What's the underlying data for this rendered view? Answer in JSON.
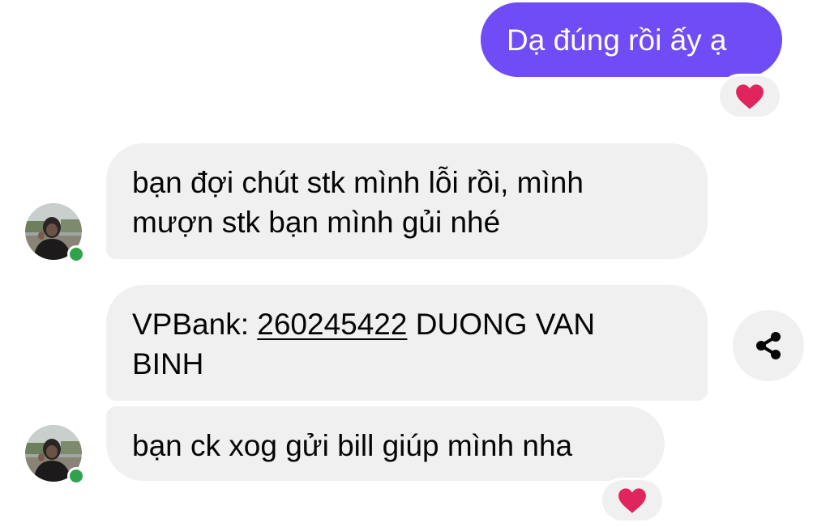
{
  "colors": {
    "accent": "#6f4cf5",
    "incoming_bubble": "#f0f0f0",
    "online": "#31a24c",
    "heart": "#e0245e"
  },
  "messages": {
    "outgoing": {
      "text": "Dạ đúng rồi ấy ạ",
      "reaction": "heart-icon"
    },
    "incoming": [
      {
        "lines": [
          "bạn đợi chút stk mình lỗi rồi, mình",
          "mượn stk bạn mình gủi nhé"
        ]
      },
      {
        "prefix": "VPBank: ",
        "account_number": "260245422",
        "suffix": " DUONG VAN",
        "line2": "BINH"
      },
      {
        "text": "bạn ck xog gửi bill giúp mình nha",
        "reaction": "heart-icon"
      }
    ]
  },
  "actions": {
    "share": "share-icon"
  }
}
